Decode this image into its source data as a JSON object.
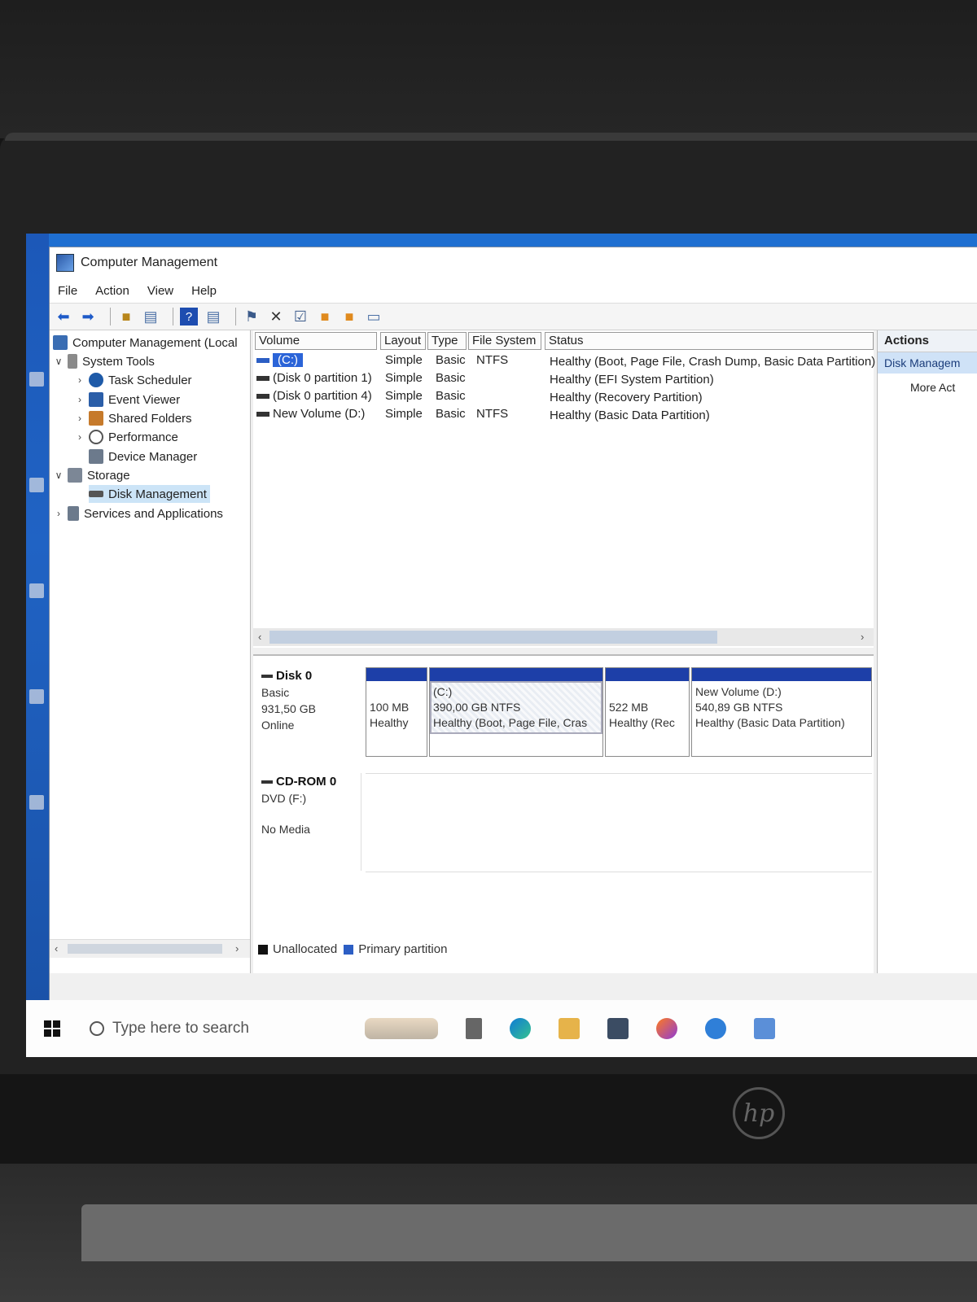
{
  "window": {
    "title": "Computer Management"
  },
  "menu": [
    "File",
    "Action",
    "View",
    "Help"
  ],
  "tree": {
    "root": "Computer Management (Local",
    "system_tools": "System Tools",
    "task_scheduler": "Task Scheduler",
    "event_viewer": "Event Viewer",
    "shared_folders": "Shared Folders",
    "performance": "Performance",
    "device_manager": "Device Manager",
    "storage": "Storage",
    "disk_management": "Disk Management",
    "services": "Services and Applications"
  },
  "volume_table": {
    "headers": [
      "Volume",
      "Layout",
      "Type",
      "File System",
      "Status"
    ],
    "rows": [
      {
        "volume": "(C:)",
        "layout": "Simple",
        "type": "Basic",
        "fs": "NTFS",
        "status": "Healthy (Boot, Page File, Crash Dump, Basic Data Partition)"
      },
      {
        "volume": "(Disk 0 partition 1)",
        "layout": "Simple",
        "type": "Basic",
        "fs": "",
        "status": "Healthy (EFI System Partition)"
      },
      {
        "volume": "(Disk 0 partition 4)",
        "layout": "Simple",
        "type": "Basic",
        "fs": "",
        "status": "Healthy (Recovery Partition)"
      },
      {
        "volume": "New Volume (D:)",
        "layout": "Simple",
        "type": "Basic",
        "fs": "NTFS",
        "status": "Healthy (Basic Data Partition)"
      }
    ]
  },
  "disk0": {
    "name": "Disk 0",
    "type": "Basic",
    "size": "931,50 GB",
    "state": "Online",
    "partitions": [
      {
        "line1": "",
        "line2": "100 MB",
        "line3": "Healthy"
      },
      {
        "line1": "(C:)",
        "line2": "390,00 GB NTFS",
        "line3": "Healthy (Boot, Page File, Cras"
      },
      {
        "line1": "",
        "line2": "522 MB",
        "line3": "Healthy (Rec"
      },
      {
        "line1": "New Volume  (D:)",
        "line2": "540,89 GB NTFS",
        "line3": "Healthy (Basic Data Partition)"
      }
    ]
  },
  "cdrom": {
    "name": "CD-ROM 0",
    "drive": "DVD (F:)",
    "media": "No Media"
  },
  "legend": {
    "unallocated": "Unallocated",
    "primary": "Primary partition"
  },
  "actions": {
    "header": "Actions",
    "selected": "Disk Managem",
    "more": "More Act"
  },
  "taskbar": {
    "search_placeholder": "Type here to search"
  },
  "colors": {
    "partition_bar": "#1d3fa8",
    "selection": "#2b64d8",
    "unallocated": "#111111",
    "primary": "#2c5ec4"
  }
}
